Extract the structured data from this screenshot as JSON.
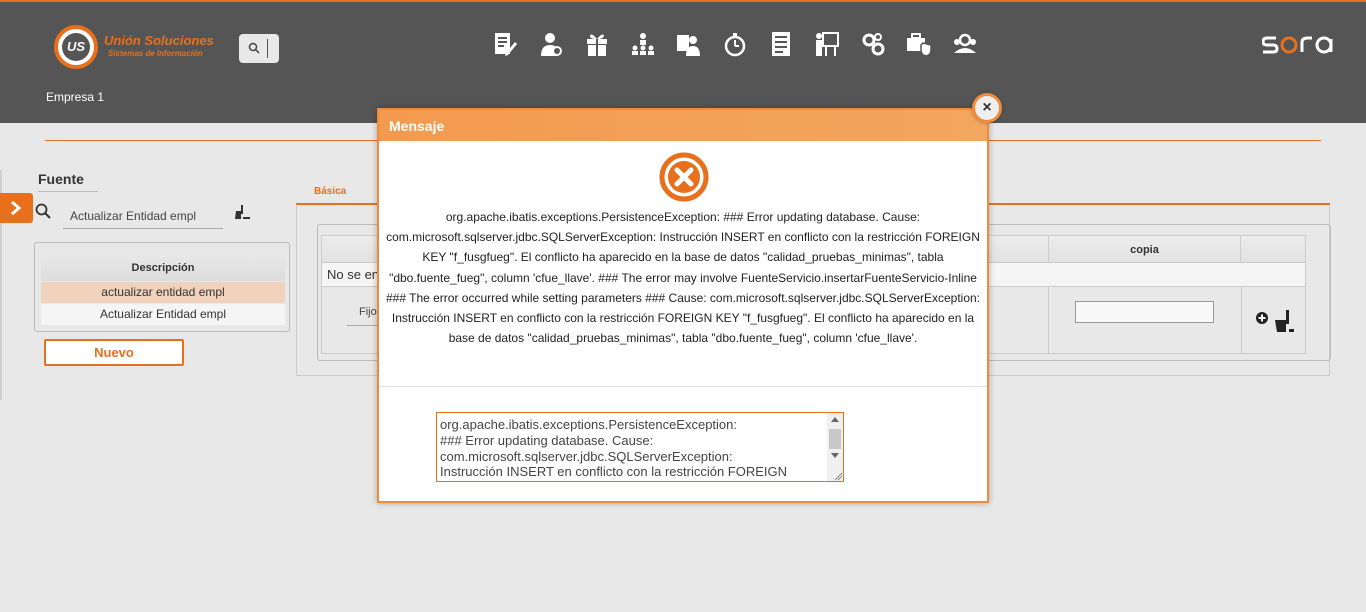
{
  "header": {
    "logo_title": "Unión Soluciones",
    "logo_subtitle": "Sistemas de Información",
    "logo_mark": "US",
    "company": "Empresa 1",
    "brand_name": "sara",
    "nav_icons": [
      "edit-document-icon",
      "user-settings-icon",
      "gift-icon",
      "org-chart-icon",
      "user-card-icon",
      "stopwatch-icon",
      "list-document-icon",
      "presentation-icon",
      "gears-icon",
      "briefcase-shield-icon",
      "users-group-icon"
    ]
  },
  "fuente": {
    "title": "Fuente",
    "search_value": "Actualizar Entidad empl",
    "table_header": "Descripción",
    "rows": [
      "actualizar entidad empl",
      "Actualizar Entidad empl"
    ],
    "new_button": "Nuevo"
  },
  "detail": {
    "tab_label": "Básica",
    "column_copia": "copia",
    "no_results": "No se en",
    "fijo_label": "Fijo"
  },
  "modal": {
    "title": "Mensaje",
    "close_label": "×",
    "message": "org.apache.ibatis.exceptions.PersistenceException: ### Error updating database. Cause: com.microsoft.sqlserver.jdbc.SQLServerException: Instrucción INSERT en conflicto con la restricción FOREIGN KEY \"f_fusgfueg\". El conflicto ha aparecido en la base de datos \"calidad_pruebas_minimas\", tabla \"dbo.fuente_fueg\", column 'cfue_llave'. ### The error may involve FuenteServicio.insertarFuenteServicio-Inline ### The error occurred while setting parameters ### Cause: com.microsoft.sqlserver.jdbc.SQLServerException: Instrucción INSERT en conflicto con la restricción FOREIGN KEY \"f_fusgfueg\". El conflicto ha aparecido en la base de datos \"calidad_pruebas_minimas\", tabla \"dbo.fuente_fueg\", column 'cfue_llave'.",
    "textarea_value": "org.apache.ibatis.exceptions.PersistenceException:\n### Error updating database.  Cause:\ncom.microsoft.sqlserver.jdbc.SQLServerException:\nInstrucción INSERT en conflicto con la restricción FOREIGN"
  },
  "colors": {
    "accent": "#e8701c",
    "topbar": "#555555",
    "modal_header": "#f39a4e",
    "selected_row": "#f1d2bc"
  }
}
